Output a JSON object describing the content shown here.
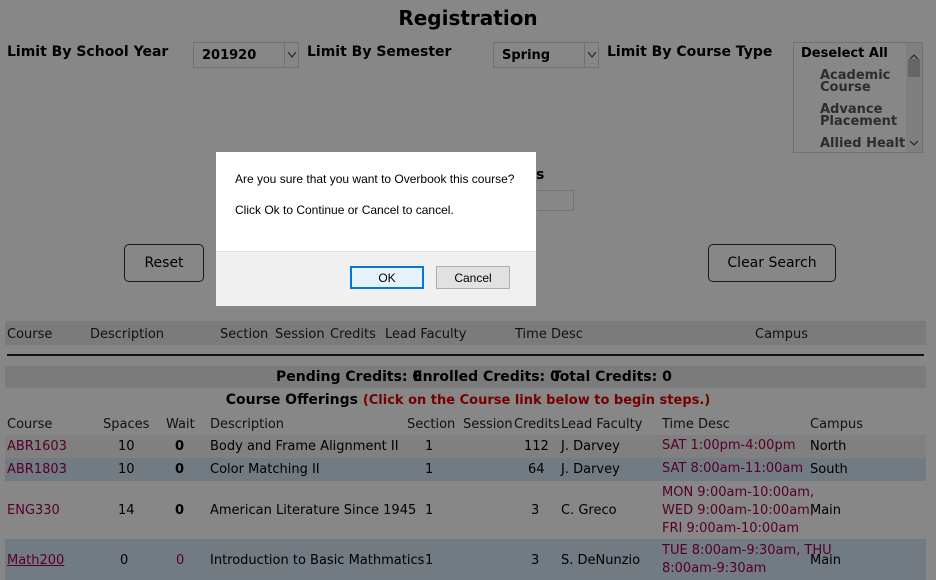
{
  "page": {
    "title": "Registration"
  },
  "filters": {
    "school_year_label": "Limit By School Year",
    "school_year_value": "201920",
    "semester_label": "Limit By Semester",
    "semester_value": "Spring",
    "course_type_label": "Limit By Course Type",
    "course_type_options": [
      "Deselect All",
      "Academic\nCourse",
      "Advance\nPlacement",
      "Allied Health"
    ],
    "partial_label": "s"
  },
  "buttons": {
    "reset": "Reset",
    "clear_search": "Clear Search"
  },
  "cart": {
    "headers": [
      "Course",
      "Description",
      "Section",
      "Session",
      "Credits",
      "Lead Faculty",
      "Time Desc",
      "Campus"
    ]
  },
  "credits": {
    "pending": "Pending Credits: 0",
    "enrolled": "Enrolled Credits: 0",
    "total": "Total Credits: 0"
  },
  "offerings": {
    "title": "Course Offerings",
    "hint": "(Click on the Course link below to begin steps.)",
    "headers": [
      "Course",
      "Spaces",
      "Wait",
      "Description",
      "Section",
      "Session",
      "Credits",
      "Lead Faculty",
      "Time Desc",
      "Campus"
    ],
    "rows": [
      {
        "course": "ABR1603",
        "spaces": "10",
        "wait": "0",
        "description": "Body and Frame Alignment II",
        "section": "1",
        "session": "",
        "credits": "112",
        "faculty": "J. Darvey",
        "time": "SAT 1:00pm-4:00pm",
        "campus": "North"
      },
      {
        "course": "ABR1803",
        "spaces": "10",
        "wait": "0",
        "description": "Color Matching II",
        "section": "1",
        "session": "",
        "credits": "64",
        "faculty": "J. Darvey",
        "time": "SAT 8:00am-11:00am",
        "campus": "South"
      },
      {
        "course": "ENG330",
        "spaces": "14",
        "wait": "0",
        "description": "American Literature Since 1945",
        "section": "1",
        "session": "",
        "credits": "3",
        "faculty": "C. Greco",
        "time": "MON 9:00am-10:00am,\nWED 9:00am-10:00am,\nFRI 9:00am-10:00am",
        "campus": "Main"
      },
      {
        "course": "Math200",
        "spaces": "0",
        "wait": "0",
        "description": "Introduction to Basic Mathmatics",
        "section": "1",
        "session": "",
        "credits": "3",
        "faculty": "S. DeNunzio",
        "time": "TUE 8:00am-9:30am, THU\n8:00am-9:30am",
        "campus": "Main"
      }
    ]
  },
  "dialog": {
    "message": "Are you sure that you want to Overbook this course?",
    "instruction": "Click Ok to Continue or Cancel to cancel.",
    "ok": "OK",
    "cancel": "Cancel"
  },
  "colors": {
    "link": "#a00050",
    "hint": "#dd0000",
    "row_blue": "#d8e6f5",
    "overlay": "rgba(0,0,0,0.47)",
    "focus": "#0078d7"
  }
}
